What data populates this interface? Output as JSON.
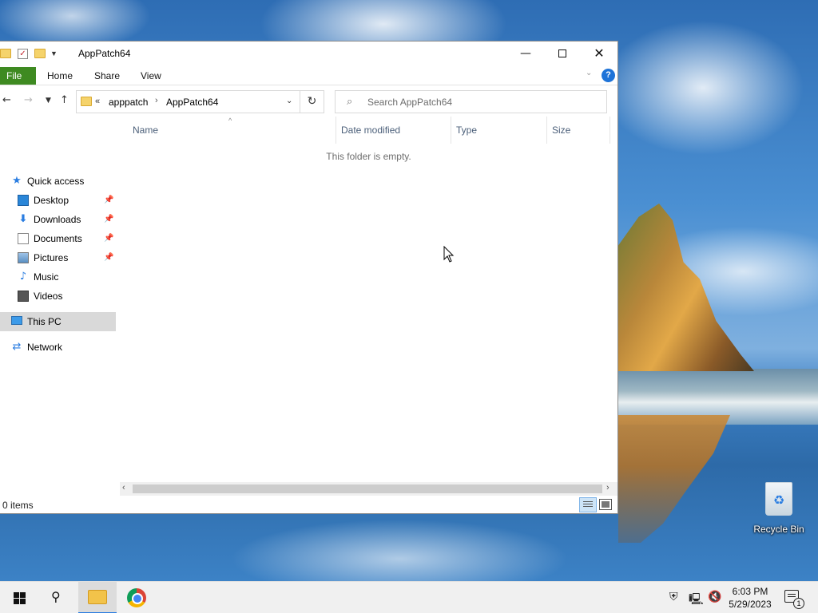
{
  "window": {
    "title": "AppPatch64",
    "ribbon": {
      "file": "File",
      "home": "Home",
      "share": "Share",
      "view": "View"
    },
    "address": {
      "crumbs": [
        "apppatch",
        "AppPatch64"
      ]
    },
    "search": {
      "placeholder": "Search AppPatch64"
    },
    "nav_pane": {
      "quick_access": "Quick access",
      "items": [
        {
          "label": "Desktop",
          "pinned": true
        },
        {
          "label": "Downloads",
          "pinned": true
        },
        {
          "label": "Documents",
          "pinned": true
        },
        {
          "label": "Pictures",
          "pinned": true
        },
        {
          "label": "Music",
          "pinned": false
        },
        {
          "label": "Videos",
          "pinned": false
        }
      ],
      "this_pc": "This PC",
      "network": "Network"
    },
    "columns": {
      "name": "Name",
      "date_modified": "Date modified",
      "type": "Type",
      "size": "Size"
    },
    "empty_message": "This folder is empty.",
    "status": "0 items"
  },
  "desktop": {
    "recycle_bin": "Recycle Bin"
  },
  "taskbar": {
    "time": "6:03 PM",
    "date": "5/29/2023",
    "notification_count": "1"
  },
  "colors": {
    "file_tab": "#3e8a21",
    "accent": "#2a7de1",
    "selection": "#d9d9d9"
  }
}
